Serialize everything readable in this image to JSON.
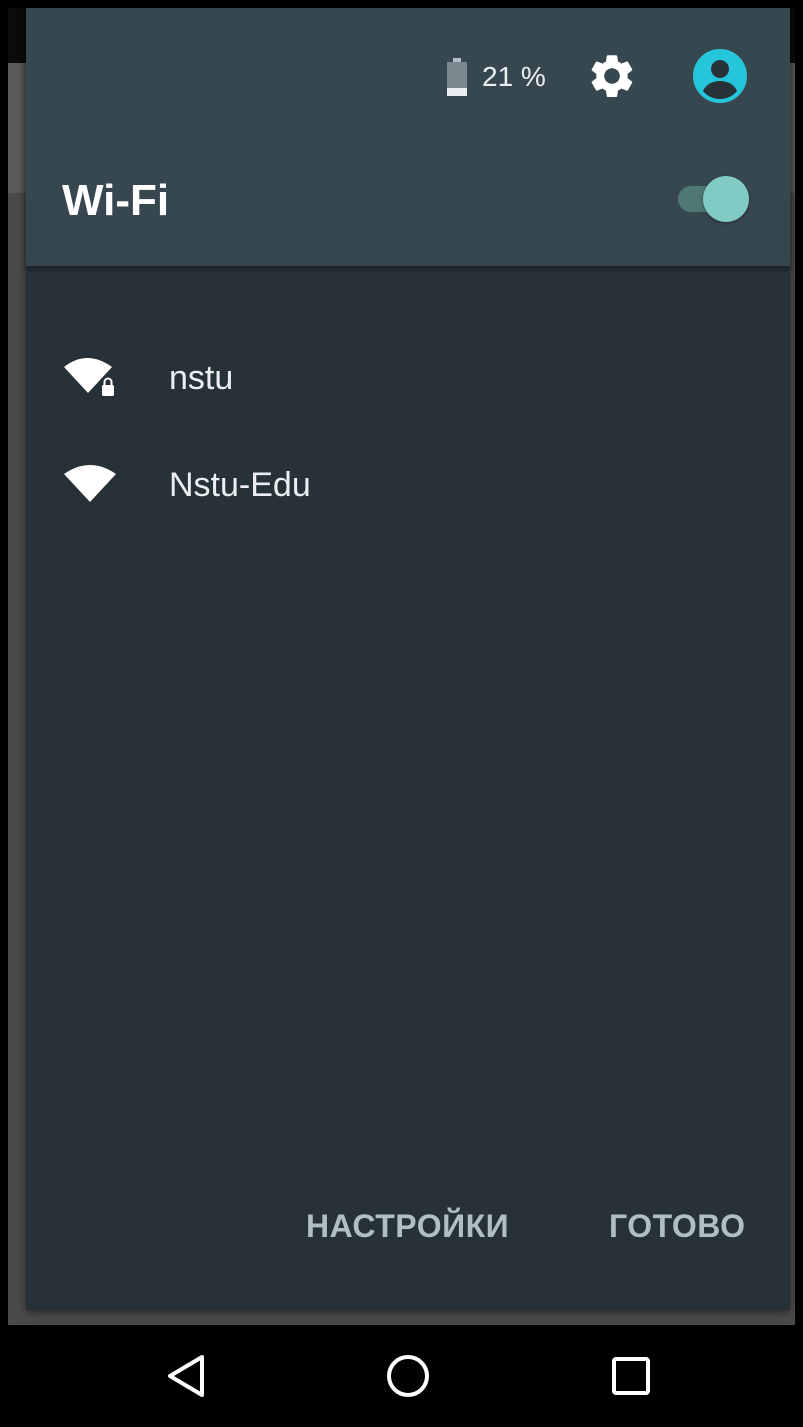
{
  "status": {
    "battery_percent": "21 %",
    "battery_icon": "battery-icon",
    "settings_icon": "gear-icon",
    "account_icon": "account-circle-icon",
    "account_color": "#26c6da"
  },
  "wifi_panel": {
    "title": "Wi-Fi",
    "toggle_on": true,
    "toggle_color": "#80cbc4",
    "networks": [
      {
        "name": "nstu",
        "secured": true,
        "icon": "wifi-lock-icon"
      },
      {
        "name": "Nstu-Edu",
        "secured": false,
        "icon": "wifi-icon"
      }
    ],
    "settings_button": "НАСТРОЙКИ",
    "done_button": "ГОТОВО"
  },
  "navbar": {
    "back_icon": "back-triangle-icon",
    "home_icon": "home-circle-icon",
    "recents_icon": "recents-square-icon"
  }
}
